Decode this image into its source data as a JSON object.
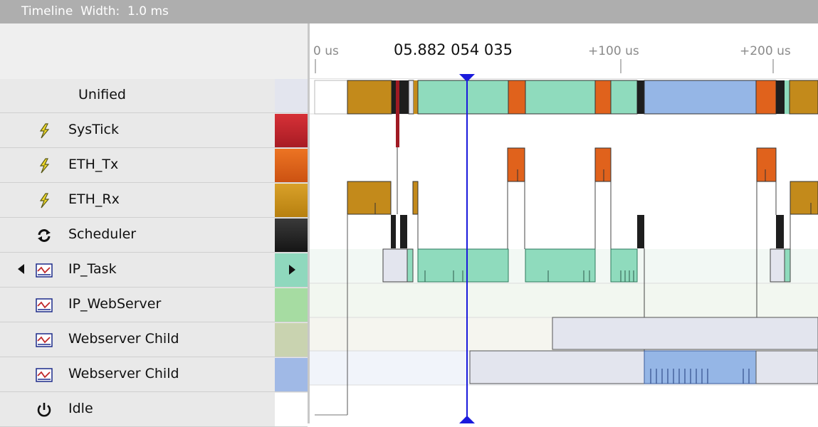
{
  "window": {
    "title": "Timeline  Width:  1.0 ms"
  },
  "ruler": {
    "cursor_time": "05.882 054 035",
    "ticks": [
      "0 us",
      "+100 us",
      "+200 us"
    ]
  },
  "rows": [
    {
      "label": "Unified",
      "icon": "none",
      "color": "#e3e5ee"
    },
    {
      "label": "SysTick",
      "icon": "lightning-icon",
      "color": "#c8262d"
    },
    {
      "label": "ETH_Tx",
      "icon": "lightning-icon",
      "color": "#e0621c"
    },
    {
      "label": "ETH_Rx",
      "icon": "lightning-icon",
      "color": "#c9921d"
    },
    {
      "label": "Scheduler",
      "icon": "scheduler-icon",
      "color": "#232323"
    },
    {
      "label": "IP_Task",
      "icon": "task-icon",
      "color": "#8fd8bd"
    },
    {
      "label": "IP_WebServer",
      "icon": "task-icon",
      "color": "#a6dca2"
    },
    {
      "label": "Webserver Child",
      "icon": "task-icon",
      "color": "#c9d3b0"
    },
    {
      "label": "Webserver Child",
      "icon": "task-icon",
      "color": "#a0b9e6"
    },
    {
      "label": "Idle",
      "icon": "power-icon",
      "color": "#ffffff"
    }
  ],
  "colors": {
    "cursor": "#1a1adc",
    "unified_bg": "#e3e5ee",
    "systick": "#a01a24",
    "eth_tx": "#e0621c",
    "eth_rx": "#c38a1b",
    "scheduler": "#1e1e1e",
    "ip_task": "#8fdbbd",
    "webserver_child": "#e3e5ee",
    "webserver_child_active": "#95b6e6"
  }
}
